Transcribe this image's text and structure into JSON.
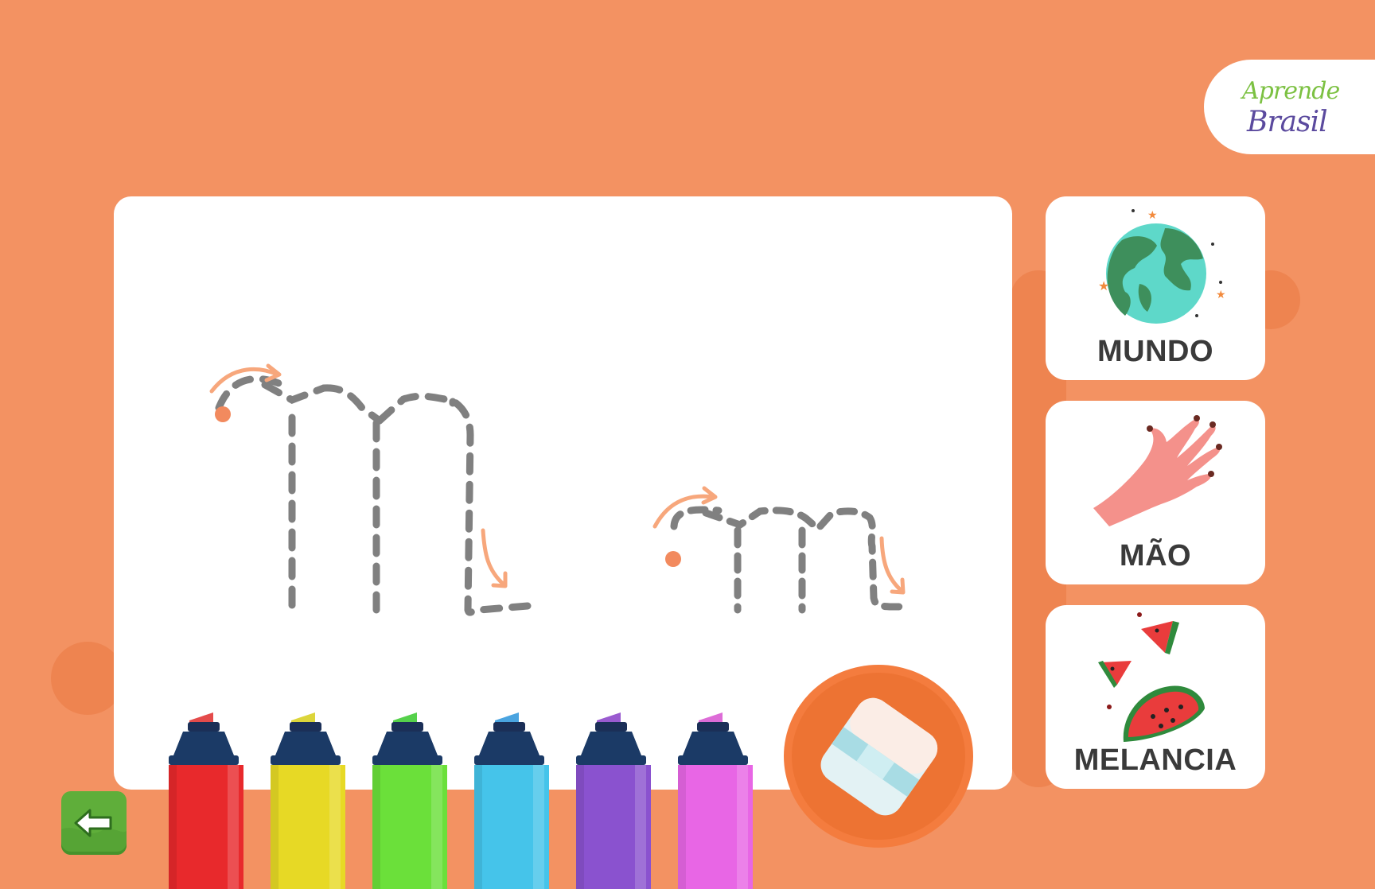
{
  "logo": {
    "line1": "Aprende",
    "line2": "Brasil"
  },
  "cards": [
    {
      "word": "MUNDO",
      "icon": "globe-icon"
    },
    {
      "word": "MÃO",
      "icon": "hand-icon"
    },
    {
      "word": "MELANCIA",
      "icon": "watermelon-icon"
    }
  ],
  "tracing": {
    "letters": [
      "M",
      "m"
    ],
    "style": "dashed-cursive-guide"
  },
  "markers": [
    {
      "color": "#E8292C",
      "tip": "#E44B4B",
      "name": "red"
    },
    {
      "color": "#E7D925",
      "tip": "#DCD53A",
      "name": "yellow"
    },
    {
      "color": "#6BE03A",
      "tip": "#55D14B",
      "name": "green"
    },
    {
      "color": "#45C4EA",
      "tip": "#4AA4E0",
      "name": "blue"
    },
    {
      "color": "#8A52CF",
      "tip": "#9A5BD0",
      "name": "purple"
    },
    {
      "color": "#E866E5",
      "tip": "#DD6CD7",
      "name": "pink"
    }
  ],
  "colors": {
    "background": "#F39262",
    "guide_dash": "#808080",
    "arrow": "#F7A77C",
    "start_dot": "#F28A5E"
  }
}
